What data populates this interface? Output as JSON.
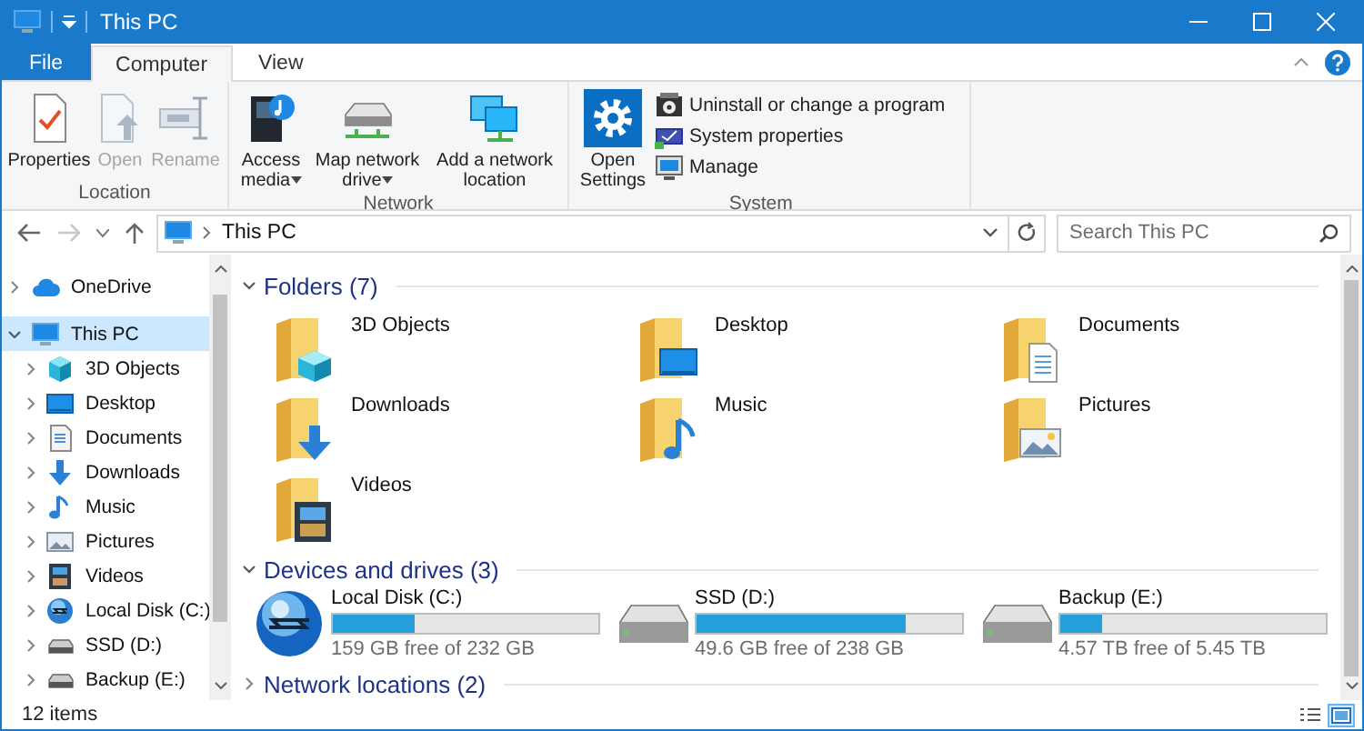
{
  "window": {
    "title": "This PC"
  },
  "ribbon_tabs": [
    {
      "label": "File",
      "kind": "file",
      "selected": false
    },
    {
      "label": "Computer",
      "kind": "tab",
      "selected": true
    },
    {
      "label": "View",
      "kind": "tab",
      "selected": false
    }
  ],
  "ribbon_groups": [
    {
      "label": "Location",
      "commands": [
        {
          "label": "Properties",
          "kind": "large",
          "disabled": false,
          "dropdown": false
        },
        {
          "label": "Open",
          "kind": "large",
          "disabled": true,
          "dropdown": false
        },
        {
          "label": "Rename",
          "kind": "large",
          "disabled": true,
          "dropdown": false
        }
      ]
    },
    {
      "label": "Network",
      "commands": [
        {
          "label": "Access media",
          "kind": "large",
          "disabled": false,
          "dropdown": true
        },
        {
          "label": "Map network drive",
          "kind": "large",
          "disabled": false,
          "dropdown": true
        },
        {
          "label": "Add a network location",
          "kind": "large",
          "disabled": false,
          "dropdown": false
        }
      ]
    },
    {
      "label": "System",
      "commands": [
        {
          "label": "Open Settings",
          "kind": "large",
          "disabled": false,
          "dropdown": false
        },
        {
          "label": "Uninstall or change a program",
          "kind": "small",
          "disabled": false,
          "dropdown": false
        },
        {
          "label": "System properties",
          "kind": "small",
          "disabled": false,
          "dropdown": false
        },
        {
          "label": "Manage",
          "kind": "small",
          "disabled": false,
          "dropdown": false
        }
      ]
    }
  ],
  "navigation": {
    "back_disabled": false,
    "forward_disabled": true
  },
  "address": {
    "path": "This PC"
  },
  "search": {
    "placeholder": "Search This PC"
  },
  "sidebar": [
    {
      "label": "OneDrive",
      "expanded": false,
      "selected": false
    },
    {
      "label": "This PC",
      "expanded": true,
      "selected": true,
      "children": [
        {
          "label": "3D Objects",
          "expanded": false,
          "selected": false
        },
        {
          "label": "Desktop",
          "expanded": false,
          "selected": false
        },
        {
          "label": "Documents",
          "expanded": false,
          "selected": false
        },
        {
          "label": "Downloads",
          "expanded": false,
          "selected": false
        },
        {
          "label": "Music",
          "expanded": false,
          "selected": false
        },
        {
          "label": "Pictures",
          "expanded": false,
          "selected": false
        },
        {
          "label": "Videos",
          "expanded": false,
          "selected": false
        },
        {
          "label": "Local Disk (C:)",
          "expanded": false,
          "selected": false
        },
        {
          "label": "SSD (D:)",
          "expanded": false,
          "selected": false
        },
        {
          "label": "Backup (E:)",
          "expanded": false,
          "selected": false
        }
      ]
    }
  ],
  "sections": [
    {
      "title": "Folders (7)",
      "kind": "folders",
      "expanded": true,
      "items": [
        {
          "name": "3D Objects"
        },
        {
          "name": "Desktop"
        },
        {
          "name": "Documents"
        },
        {
          "name": "Downloads"
        },
        {
          "name": "Music"
        },
        {
          "name": "Pictures"
        },
        {
          "name": "Videos"
        }
      ]
    },
    {
      "title": "Devices and drives (3)",
      "kind": "drives",
      "expanded": true,
      "drives": [
        {
          "name": "Local Disk (C:)",
          "level": 0.31,
          "reading": "159 GB free of 232 GB"
        },
        {
          "name": "SSD (D:)",
          "level": 0.79,
          "reading": "49.6 GB free of 238 GB"
        },
        {
          "name": "Backup (E:)",
          "level": 0.16,
          "reading": "4.57 TB free of 5.45 TB"
        }
      ]
    },
    {
      "title": "Network locations (2)",
      "expanded": false
    }
  ],
  "status_bar": {
    "text": "12 items"
  },
  "views": [
    {
      "kind": "details",
      "selected": false
    },
    {
      "kind": "large_icons",
      "selected": true
    }
  ]
}
